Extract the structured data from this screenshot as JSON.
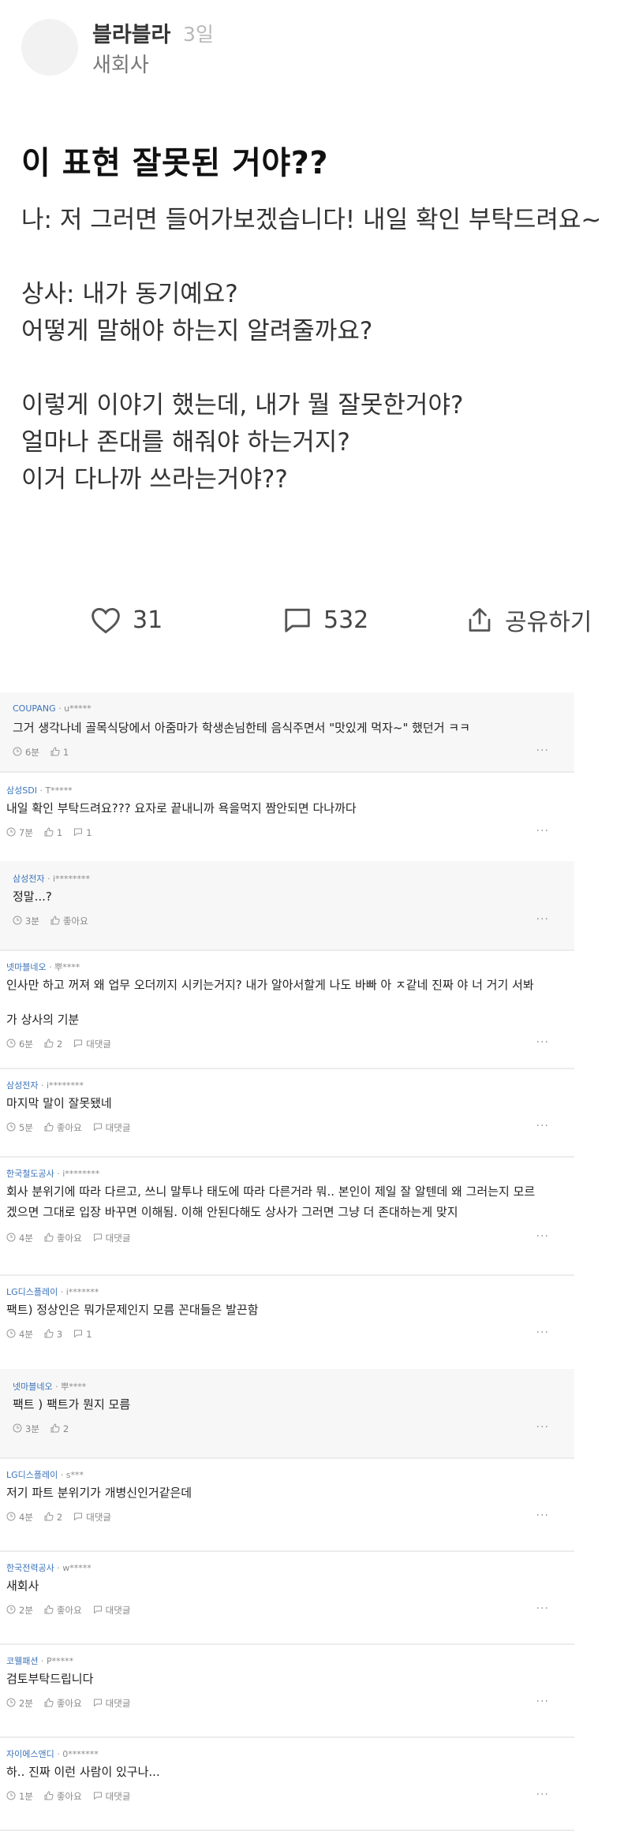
{
  "post": {
    "author": "블라블라",
    "time_ago": "3일",
    "company": "새회사",
    "title": "이 표현 잘못된 거야??",
    "body_lines": [
      "나: 저 그러면 들어가보겠습니다! 내일 확인 부탁드려요~",
      "",
      "상사: 내가 동기예요?",
      "어떻게 말해야 하는지 알려줄까요?",
      "",
      "이렇게 이야기 했는데, 내가 뭘 잘못한거야?",
      "얼마나 존대를 해줘야 하는거지?",
      "이거 다나까 쓰라는거야??"
    ],
    "likes": "31",
    "comment_count": "532",
    "share_label": "공유하기"
  },
  "comments": [
    {
      "company": "COUPANG",
      "nick": "u*****",
      "text": "그거 생각나네 골목식당에서 아줌마가 학생손님한테 음식주면서 \"맛있게 먹자~\" 했던거 ㅋㅋ",
      "text2": "",
      "time": "6분",
      "likes": "1",
      "replies": "",
      "reply": true
    },
    {
      "company": "삼성SDI",
      "nick": "T*****",
      "text": "내일 확인 부탁드려요??? 요자로 끝내니까 욕을먹지 짬안되면 다나까다",
      "text2": "",
      "time": "7분",
      "likes": "1",
      "replies": "1",
      "reply": false
    },
    {
      "company": "삼성전자",
      "nick": "i********",
      "text": "정말...?",
      "text2": "",
      "time": "3분",
      "likes": "좋아요",
      "replies": "",
      "reply": true
    },
    {
      "company": "넷마블네오",
      "nick": "뿌****",
      "text": "인사만 하고 꺼져 왜 업무 오더끼지 시키는거지? 내가 알아서할게 나도 바빠 아 ㅈ같네 진짜 야 너 거기 서봐",
      "text2": "가 상사의 기분",
      "time": "6분",
      "likes": "2",
      "replies": "대댓글",
      "reply": false
    },
    {
      "company": "삼성전자",
      "nick": "i********",
      "text": "마지막 말이 잘못됐네",
      "text2": "",
      "time": "5분",
      "likes": "좋아요",
      "replies": "대댓글",
      "reply": false
    },
    {
      "company": "한국철도공사",
      "nick": "i********",
      "text": "회사 분위기에 따라 다르고, 쓰니 말투나 태도에 따라 다른거라 뭐.. 본인이 제일 잘 알텐데 왜 그러는지 모르",
      "text2": "겠으면 그대로 입장 바꾸면 이해됨. 이해 안된다해도 상사가 그러면 그냥 더 존대하는게 맞지",
      "time": "4분",
      "likes": "좋아요",
      "replies": "대댓글",
      "reply": false
    },
    {
      "company": "LG디스플레이",
      "nick": "i*******",
      "text": "팩트) 정상인은 뭐가문제인지 모름 꼰대들은 발끈함",
      "text2": "",
      "time": "4분",
      "likes": "3",
      "replies": "1",
      "reply": false
    },
    {
      "company": "넷마블네오",
      "nick": "뿌****",
      "text": "팩트 ) 팩트가 뭔지 모름",
      "text2": "",
      "time": "3분",
      "likes": "2",
      "replies": "",
      "reply": true
    },
    {
      "company": "LG디스플레이",
      "nick": "s***",
      "text": "저기 파트 분위기가 개병신인거같은데",
      "text2": "",
      "time": "4분",
      "likes": "2",
      "replies": "대댓글",
      "reply": false
    },
    {
      "company": "한국전력공사",
      "nick": "w*****",
      "text": "새회사",
      "text2": "",
      "time": "2분",
      "likes": "좋아요",
      "replies": "대댓글",
      "reply": false
    },
    {
      "company": "코웰패션",
      "nick": "P*****",
      "text": "검토부탁드립니다",
      "text2": "",
      "time": "2분",
      "likes": "좋아요",
      "replies": "대댓글",
      "reply": false
    },
    {
      "company": "자이에스앤디",
      "nick": "0*******",
      "text": "하.. 진짜 이런 사람이 있구나...",
      "text2": "",
      "time": "1분",
      "likes": "좋아요",
      "replies": "대댓글",
      "reply": false
    }
  ],
  "more_label": "···",
  "nick_separator": " · ",
  "colors": {
    "company": "#3b73b9",
    "reply_bg": "#f7f7f7"
  },
  "icons": {
    "like": "heart-icon",
    "comment": "speech-bubble-icon",
    "share": "share-icon",
    "time": "clock-icon",
    "thumb": "thumbs-up-icon",
    "reply": "reply-bubble-icon"
  }
}
